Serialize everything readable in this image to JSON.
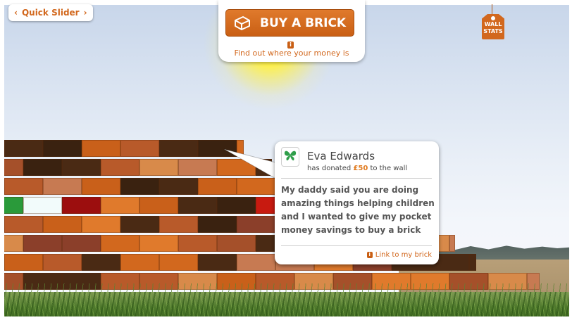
{
  "nav": {
    "quick_slider": {
      "prev_glyph": "‹",
      "label": "Quick Slider",
      "next_glyph": "›"
    }
  },
  "buy": {
    "button_label": "BUY A BRICK",
    "info_glyph": "i",
    "find_out_text": "Find out where your money is"
  },
  "wall_stats": {
    "line1": "WALL",
    "line2": "STATS"
  },
  "donation": {
    "name": "Eva Edwards",
    "donated_prefix": "has donated",
    "amount": "£50",
    "donated_suffix": "to the wall",
    "message": "My daddy said you are doing amazing things helping children and I wanted to give my pocket money savings to buy a brick",
    "link_label": "Link to my brick",
    "avatar_icon": "butterfly-icon"
  },
  "colors": {
    "accent": "#d2681e",
    "button": "#c95f14",
    "amount": "#e07a1e",
    "avatar_icon": "#2f9e4a"
  }
}
